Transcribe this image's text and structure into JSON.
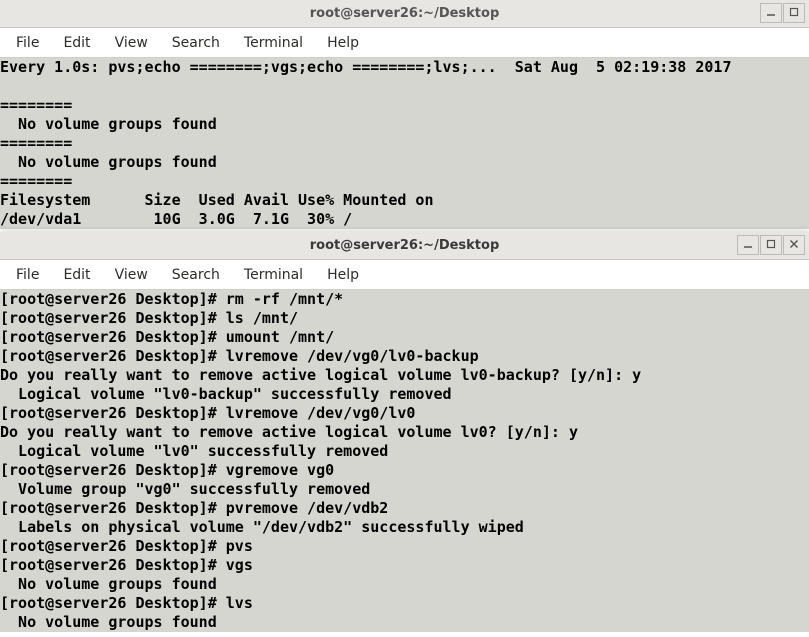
{
  "menu": {
    "items": [
      "File",
      "Edit",
      "View",
      "Search",
      "Terminal",
      "Help"
    ]
  },
  "win1": {
    "title": "root@server26:~/Desktop",
    "lines": [
      "Every 1.0s: pvs;echo ========;vgs;echo ========;lvs;...  Sat Aug  5 02:19:38 2017",
      "",
      "========",
      "  No volume groups found",
      "========",
      "  No volume groups found",
      "========",
      "Filesystem      Size  Used Avail Use% Mounted on",
      "/dev/vda1        10G  3.0G  7.1G  30% /"
    ]
  },
  "win2": {
    "title": "root@server26:~/Desktop",
    "lines": [
      "[root@server26 Desktop]# rm -rf /mnt/*",
      "[root@server26 Desktop]# ls /mnt/",
      "[root@server26 Desktop]# umount /mnt/",
      "[root@server26 Desktop]# lvremove /dev/vg0/lv0-backup",
      "Do you really want to remove active logical volume lv0-backup? [y/n]: y",
      "  Logical volume \"lv0-backup\" successfully removed",
      "[root@server26 Desktop]# lvremove /dev/vg0/lv0",
      "Do you really want to remove active logical volume lv0? [y/n]: y",
      "  Logical volume \"lv0\" successfully removed",
      "[root@server26 Desktop]# vgremove vg0",
      "  Volume group \"vg0\" successfully removed",
      "[root@server26 Desktop]# pvremove /dev/vdb2",
      "  Labels on physical volume \"/dev/vdb2\" successfully wiped",
      "[root@server26 Desktop]# pvs",
      "[root@server26 Desktop]# vgs",
      "  No volume groups found",
      "[root@server26 Desktop]# lvs",
      "  No volume groups found"
    ]
  },
  "icons": {
    "minimize": "minimize-icon",
    "maximize": "maximize-icon",
    "close": "close-icon"
  }
}
